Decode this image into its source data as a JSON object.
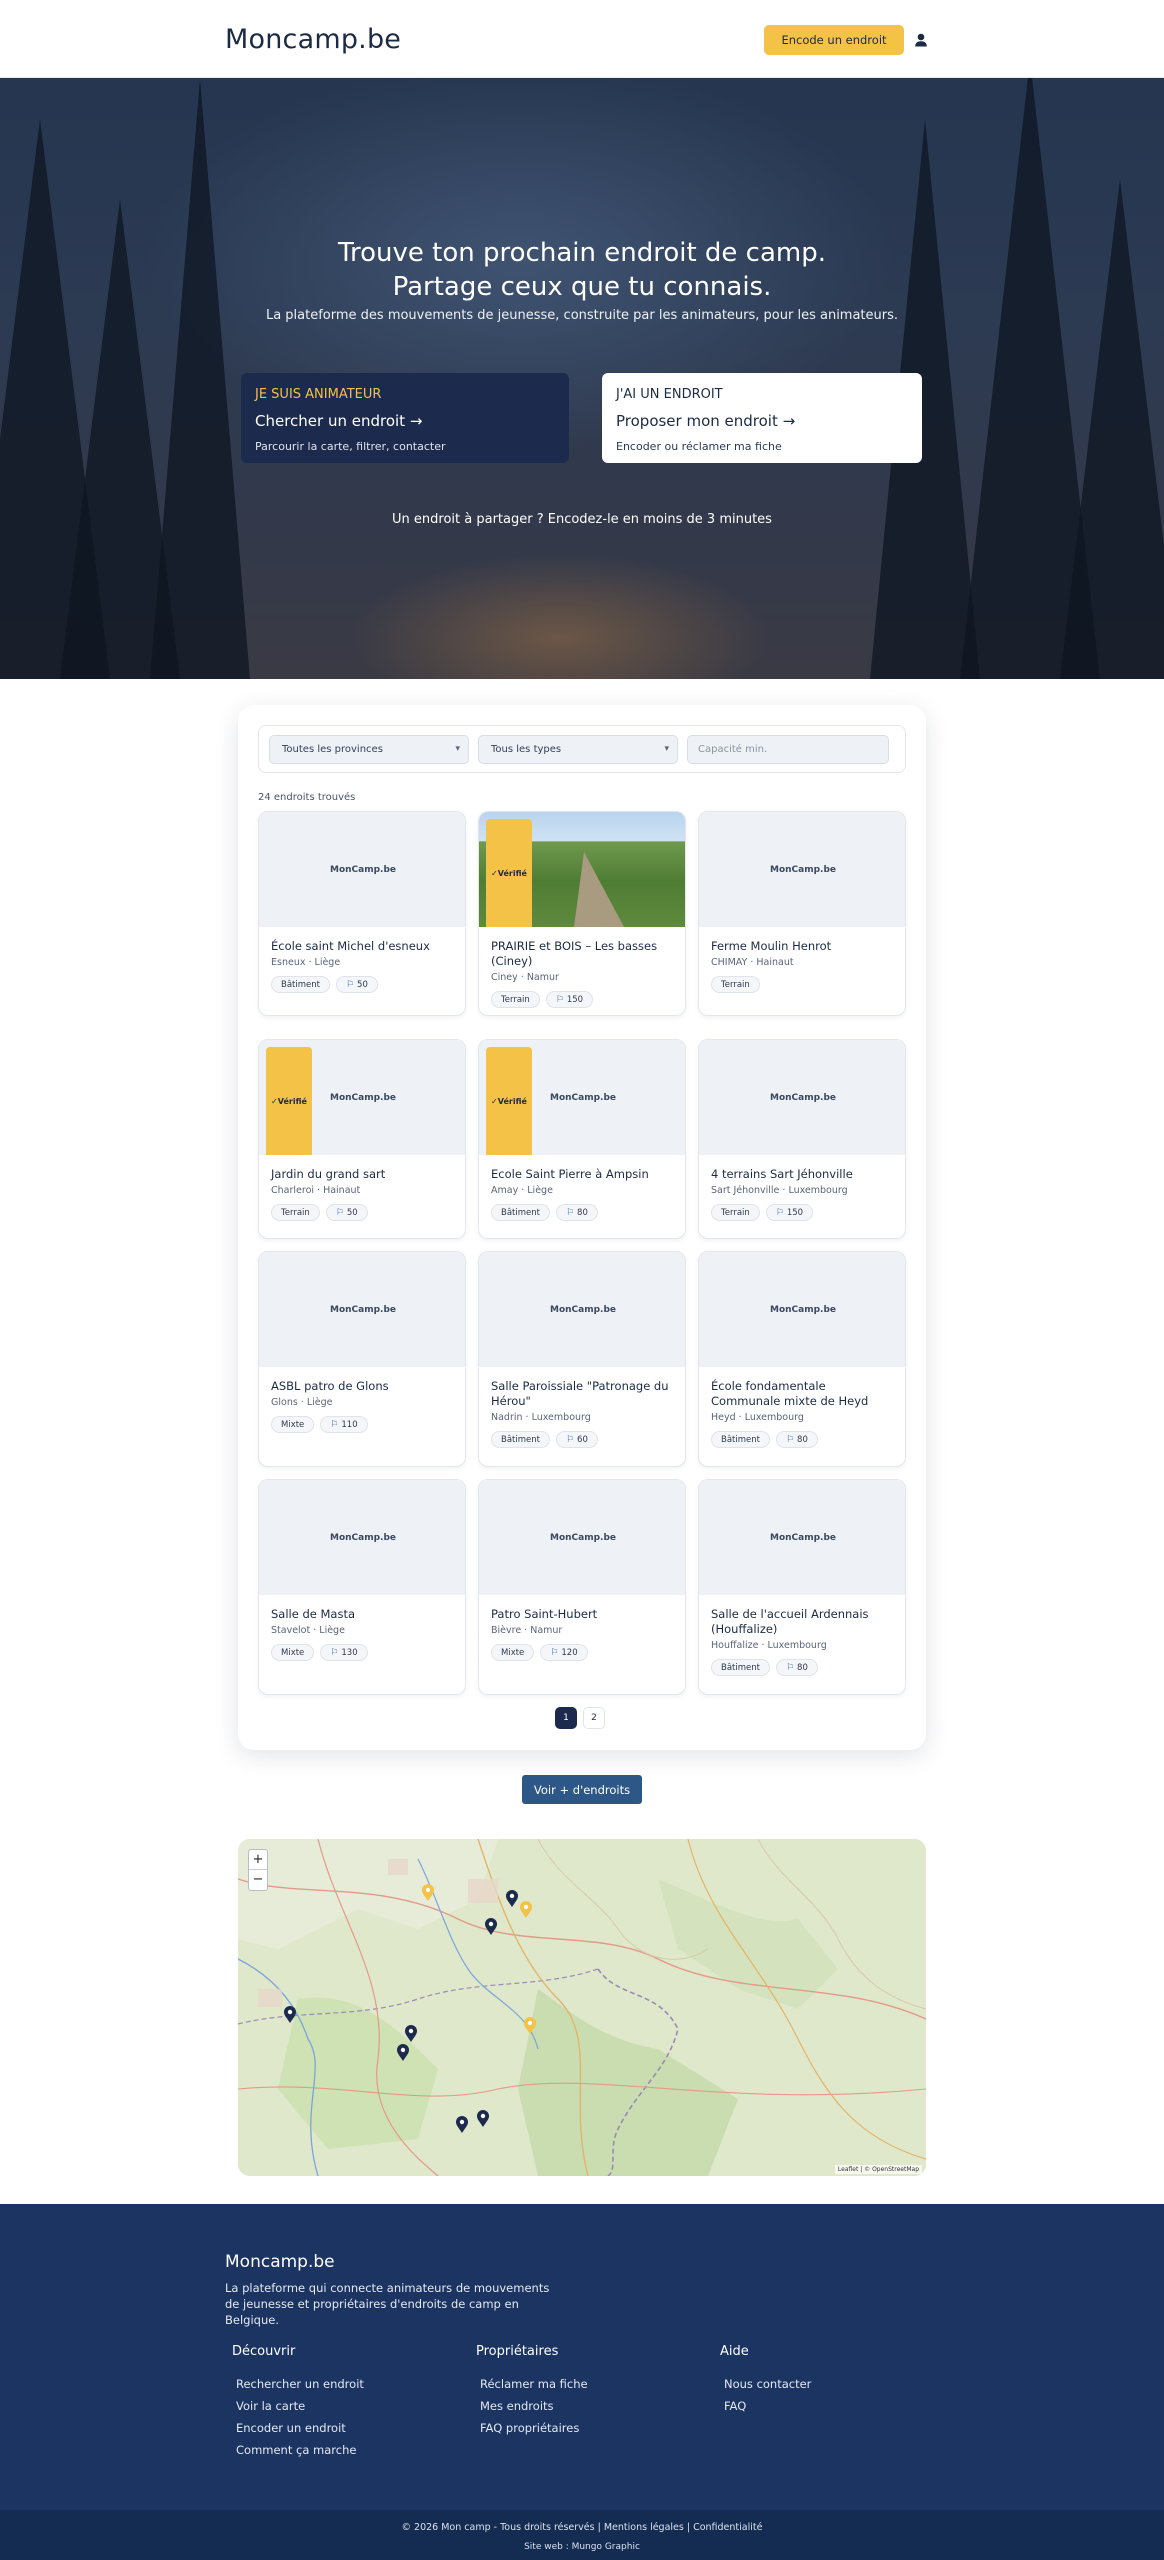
{
  "header": {
    "brand": "Moncamp.be",
    "encode_button": "Encode un endroit",
    "user_icon": "user-icon"
  },
  "hero": {
    "title_line1": "Trouve ton prochain endroit de camp.",
    "title_line2": "Partage ceux que tu connais.",
    "subtitle": "La plateforme des mouvements de jeunesse, construite par les animateurs, pour les animateurs.",
    "card_animator": {
      "eyebrow": "JE SUIS ANIMATEUR",
      "title": "Chercher un endroit →",
      "desc": "Parcourir la carte, filtrer, contacter"
    },
    "card_owner": {
      "eyebrow": "J'AI UN ENDROIT",
      "title": "Proposer mon endroit →",
      "desc": "Encoder ou réclamer ma fiche"
    },
    "cta": "Un endroit à partager ? Encodez-le en moins de 3 minutes"
  },
  "filters": {
    "province": "Toutes les provinces",
    "type": "Tous les types",
    "capacity_placeholder": "Capacité min."
  },
  "results_count": "24 endroits trouvés",
  "placeholder_label": "MonCamp.be",
  "verified_label": "✓Vérifié",
  "places": [
    {
      "name": "École saint Michel d'esneux",
      "location": "Esneux · Liège",
      "type": "Bâtiment",
      "capacity": "50",
      "verified": false
    },
    {
      "name": "PRAIRIE et BOIS – Les basses (Ciney)",
      "location": "Ciney · Namur",
      "type": "Terrain",
      "capacity": "150",
      "verified": true
    },
    {
      "name": "Ferme Moulin Henrot",
      "location": "CHIMAY · Hainaut",
      "type": "Terrain",
      "capacity": "",
      "verified": false
    },
    {
      "name": "Jardin du grand sart",
      "location": "Charleroi · Hainaut",
      "type": "Terrain",
      "capacity": "50",
      "verified": true
    },
    {
      "name": "Ecole Saint Pierre à Ampsin",
      "location": "Amay · Liège",
      "type": "Bâtiment",
      "capacity": "80",
      "verified": true
    },
    {
      "name": "4 terrains Sart Jéhonville",
      "location": "Sart Jéhonville · Luxembourg",
      "type": "Terrain",
      "capacity": "150",
      "verified": false
    },
    {
      "name": "ASBL patro de Glons",
      "location": "Glons · Liège",
      "type": "Mixte",
      "capacity": "110",
      "verified": false
    },
    {
      "name": "Salle Paroissiale \"Patronage du Hérou\"",
      "location": "Nadrin · Luxembourg",
      "type": "Bâtiment",
      "capacity": "60",
      "verified": false
    },
    {
      "name": "École fondamentale Communale mixte de Heyd",
      "location": "Heyd · Luxembourg",
      "type": "Bâtiment",
      "capacity": "80",
      "verified": false
    },
    {
      "name": "Salle de Masta",
      "location": "Stavelot · Liège",
      "type": "Mixte",
      "capacity": "130",
      "verified": false
    },
    {
      "name": "Patro Saint-Hubert",
      "location": "Bièvre · Namur",
      "type": "Mixte",
      "capacity": "120",
      "verified": false
    },
    {
      "name": "Salle de l'accueil Ardennais (Houffalize)",
      "location": "Houffalize · Luxembourg",
      "type": "Bâtiment",
      "capacity": "80",
      "verified": false
    }
  ],
  "pagination": [
    "1",
    "2"
  ],
  "more_button": "Voir + d'endroits",
  "map": {
    "zoom_in": "+",
    "zoom_out": "−",
    "attribution": "Leaflet | © OpenStreetMap"
  },
  "footer": {
    "brand": "Moncamp.be",
    "tagline": "La plateforme qui connecte animateurs de mouvements de jeunesse et propriétaires d'endroits de camp en Belgique.",
    "columns": [
      {
        "title": "Découvrir",
        "links": [
          "Rechercher un endroit",
          "Voir la carte",
          "Encoder un endroit",
          "Comment ça marche"
        ]
      },
      {
        "title": "Propriétaires",
        "links": [
          "Réclamer ma fiche",
          "Mes endroits",
          "FAQ propriétaires"
        ]
      },
      {
        "title": "Aide",
        "links": [
          "Nous contacter",
          "FAQ"
        ]
      }
    ],
    "copyright": "© 2026 Mon camp - Tous droits réservés | Mentions légales | Confidentialité",
    "credits": "Site web : Mungo Graphic"
  },
  "colors": {
    "accent": "#f3c246",
    "navy": "#1c2b4d",
    "footer": "#1b3461",
    "button_blue": "#2d5786"
  }
}
